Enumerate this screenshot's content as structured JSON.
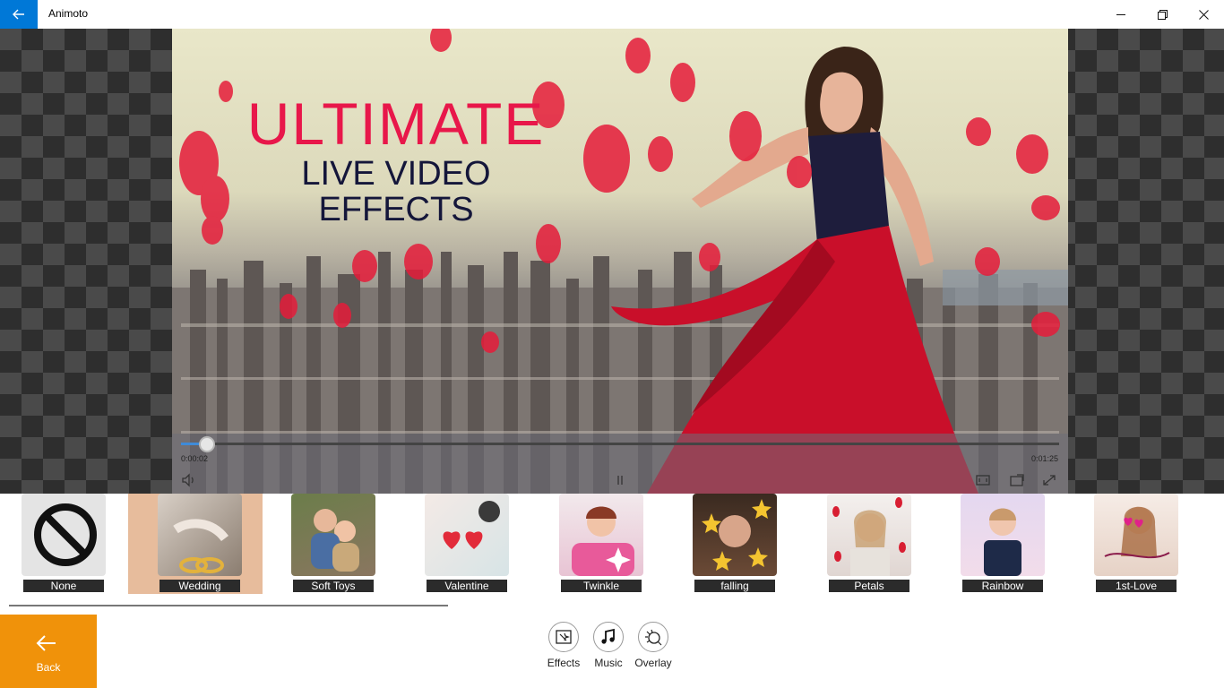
{
  "window": {
    "title": "Animoto",
    "controls": [
      "minimize",
      "restore",
      "close"
    ]
  },
  "video": {
    "overlay_line1": "ULTIMATE",
    "overlay_line2": "LIVE VIDEO EFFECTS",
    "progress": 0.03,
    "elapsed": "0:00:02",
    "duration": "0:01:25"
  },
  "effects": [
    {
      "label": "None",
      "icon": "no-entry-icon",
      "selected": false
    },
    {
      "label": "Wedding",
      "icon": "wedding-rings-thumbnail",
      "selected": true
    },
    {
      "label": "Soft Toys",
      "icon": "children-thumbnail",
      "selected": false
    },
    {
      "label": "Valentine",
      "icon": "valentine-hearts-thumbnail",
      "selected": false
    },
    {
      "label": "Twinkle",
      "icon": "twinkle-girl-thumbnail",
      "selected": false
    },
    {
      "label": "falling",
      "icon": "falling-stars-thumbnail",
      "selected": false
    },
    {
      "label": "Petals",
      "icon": "rose-petals-thumbnail",
      "selected": false
    },
    {
      "label": "Rainbow",
      "icon": "rainbow-woman-thumbnail",
      "selected": false
    },
    {
      "label": "1st-Love",
      "icon": "first-love-thumbnail",
      "selected": false
    }
  ],
  "bottom_bar": {
    "back_label": "Back",
    "tools": [
      {
        "label": "Effects",
        "icon": "effects-icon"
      },
      {
        "label": "Music",
        "icon": "music-note-icon"
      },
      {
        "label": "Overlay",
        "icon": "overlay-icon"
      }
    ]
  },
  "colors": {
    "accent_blue": "#0078d7",
    "back_orange": "#f0920a",
    "title_red": "#e8174a",
    "selected_tile": "#e7bc9c"
  }
}
